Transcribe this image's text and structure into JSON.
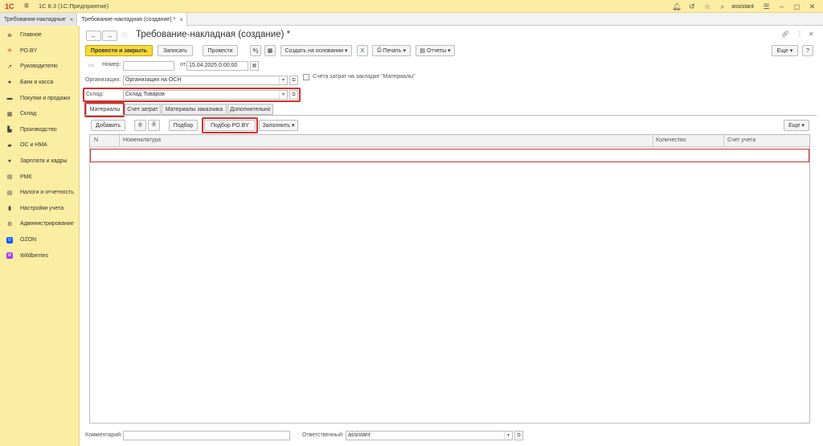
{
  "app": {
    "logo": "1С",
    "title": "1С 8.3  (1С:Предприятие)",
    "user": "assistant"
  },
  "window_tabs": [
    {
      "label": "Требования-накладные"
    },
    {
      "label": "Требование-накладная (создание) *"
    }
  ],
  "sidebar": {
    "items": [
      {
        "label": "Главное",
        "icon": "list-icon"
      },
      {
        "label": "РО.BY",
        "icon": "asterisk-icon"
      },
      {
        "label": "Руководителю",
        "icon": "trend-icon"
      },
      {
        "label": "Банк и касса",
        "icon": "coins-icon"
      },
      {
        "label": "Покупки и продажи",
        "icon": "cart-icon"
      },
      {
        "label": "Склад",
        "icon": "warehouse-icon"
      },
      {
        "label": "Производство",
        "icon": "factory-icon"
      },
      {
        "label": "ОС и НМА",
        "icon": "truck-icon"
      },
      {
        "label": "Зарплата и кадры",
        "icon": "person-icon"
      },
      {
        "label": "РМК",
        "icon": "register-icon"
      },
      {
        "label": "Налоги и отчетность",
        "icon": "document-icon"
      },
      {
        "label": "Настройки учета",
        "icon": "book-icon"
      },
      {
        "label": "Администрирование",
        "icon": "gear-icon"
      },
      {
        "label": "OZON",
        "icon": "ozon-icon"
      },
      {
        "label": "Wildberries",
        "icon": "wildberries-icon"
      }
    ]
  },
  "form": {
    "title": "Требование-накладная (создание) *",
    "toolbar": {
      "post_close": "Провести и закрыть",
      "save": "Записать",
      "post": "Провести",
      "create_based": "Создать на основании",
      "print": "Печать",
      "reports": "Отчеты",
      "more": "Еще",
      "help": "?"
    },
    "number_label": "Номер:",
    "number_value": "",
    "date_label": "от:",
    "date_value": "15.04.2025  0:00:00",
    "org_label": "Организация:",
    "org_value": "Организация на ОСН",
    "accounts_checkbox": "Счета затрат на закладке \"Материалы\"",
    "warehouse_label": "Склад:",
    "warehouse_value": "Склад Товаров",
    "tabs": [
      "Материалы",
      "Счет затрат",
      "Материалы заказчика",
      "Дополнительно"
    ],
    "table_toolbar": {
      "add": "Добавить",
      "pick": "Подбор",
      "pick_roby": "Подбор РО.BY",
      "fill": "Заполнить",
      "more": "Еще"
    },
    "columns": [
      "N",
      "Номенклатура",
      "Количество",
      "Счет учета"
    ],
    "comment_label": "Комментарий:",
    "comment_value": "",
    "responsible_label": "Ответственный:",
    "responsible_value": "assistant"
  },
  "colors": {
    "accent": "#f7d93b",
    "highlight": "#d0312d",
    "sidebar": "#fbeda2"
  }
}
